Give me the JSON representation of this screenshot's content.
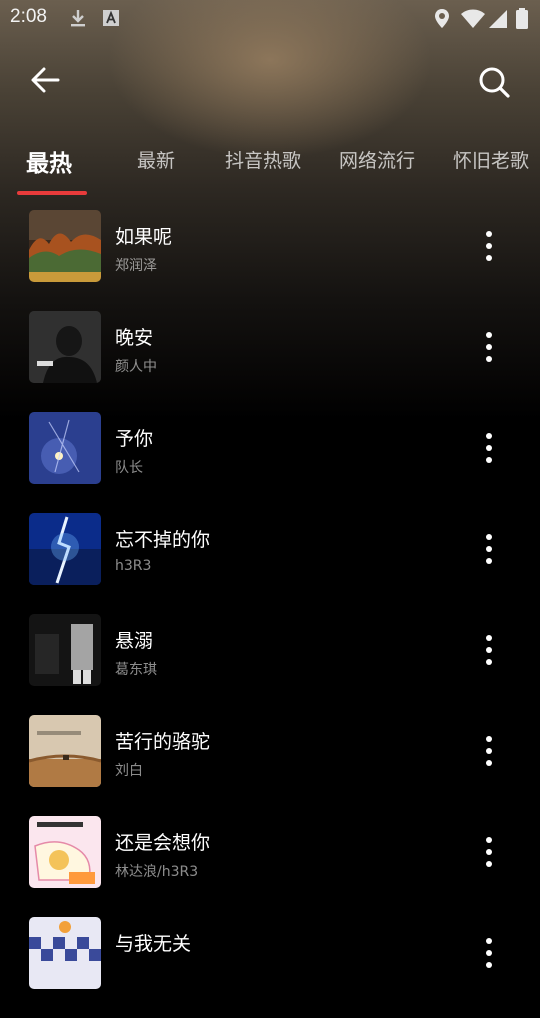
{
  "status_bar": {
    "time": "2:08",
    "icons": [
      "download-icon",
      "font-a-icon",
      "location-icon",
      "wifi-icon",
      "signal-icon",
      "battery-icon"
    ]
  },
  "header": {
    "back_icon": "arrow-left-icon",
    "search_icon": "search-icon"
  },
  "tabs": [
    {
      "label": "最热",
      "active": true
    },
    {
      "label": "最新",
      "active": false
    },
    {
      "label": "抖音热歌",
      "active": false
    },
    {
      "label": "网络流行",
      "active": false
    },
    {
      "label": "怀旧老歌",
      "active": false
    }
  ],
  "colors": {
    "accent": "#e93b3b",
    "background": "#000000"
  },
  "songs": [
    {
      "title": "如果呢",
      "artist": "郑润泽"
    },
    {
      "title": "晚安",
      "artist": "颜人中"
    },
    {
      "title": "予你",
      "artist": "队长"
    },
    {
      "title": "忘不掉的你",
      "artist": "h3R3"
    },
    {
      "title": "悬溺",
      "artist": "葛东琪"
    },
    {
      "title": "苦行的骆驼",
      "artist": "刘白"
    },
    {
      "title": "还是会想你",
      "artist": "林达浪/h3R3"
    },
    {
      "title": "与我无关",
      "artist": ""
    }
  ]
}
